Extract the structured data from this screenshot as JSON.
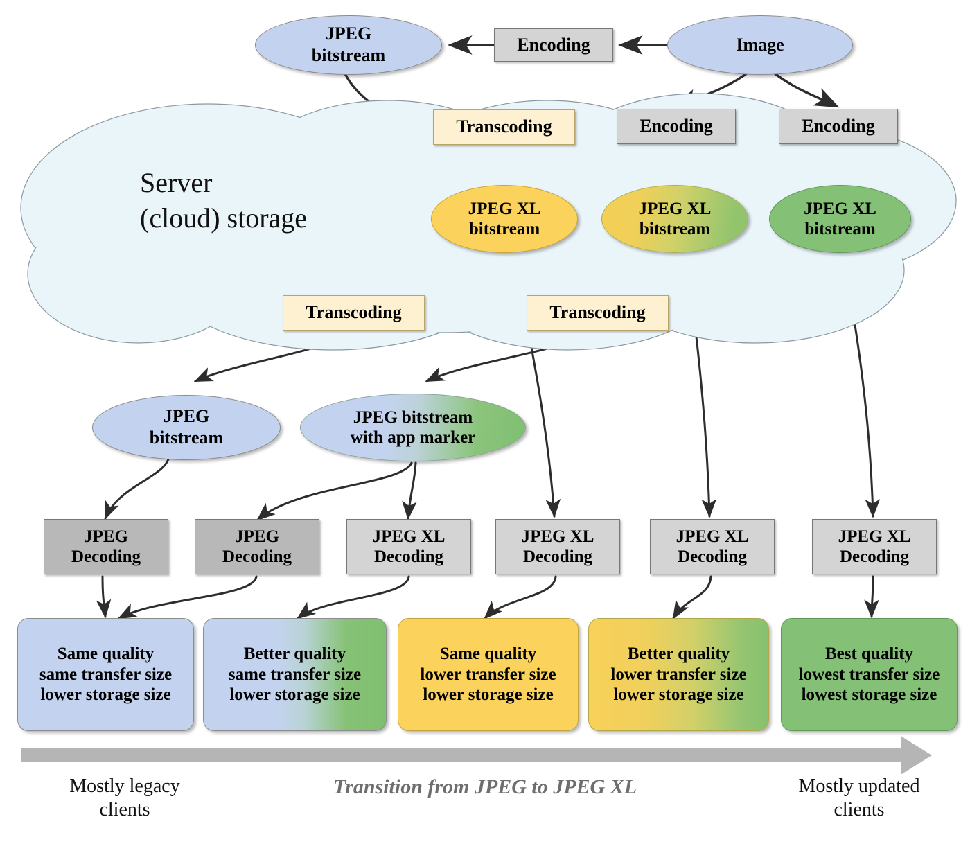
{
  "diagram": {
    "title_text": "Transition from JPEG to JPEG XL",
    "cloud_label_line1": "Server",
    "cloud_label_line2": "(cloud) storage",
    "colors": {
      "blue": "#c3d3ef",
      "amber": "#fbd35c",
      "green": "#84c075",
      "cream": "#fdf1d2",
      "gray": "#d4d4d4",
      "gray_dark": "#b8b8b8",
      "cloud_fill": "#eaf5fa",
      "arrow_gray": "#b3b3b3",
      "emph_text": "#6e6e6e"
    }
  },
  "top_row": {
    "jpeg_bitstream": {
      "line1": "JPEG",
      "line2": "bitstream"
    },
    "encoding": {
      "label": "Encoding"
    },
    "image": {
      "label": "Image"
    }
  },
  "server_row": {
    "transcoding": {
      "label": "Transcoding"
    },
    "encoding_mid": {
      "label": "Encoding"
    },
    "encoding_right": {
      "label": "Encoding"
    },
    "jxl_a": {
      "line1": "JPEG XL",
      "line2": "bitstream"
    },
    "jxl_b": {
      "line1": "JPEG XL",
      "line2": "bitstream"
    },
    "jxl_c": {
      "line1": "JPEG XL",
      "line2": "bitstream"
    }
  },
  "transcode_row": {
    "transcoding_left": {
      "label": "Transcoding"
    },
    "transcoding_right": {
      "label": "Transcoding"
    }
  },
  "client_bitstreams": {
    "jpeg_plain": {
      "line1": "JPEG",
      "line2": "bitstream"
    },
    "jpeg_marker": {
      "line1": "JPEG bitstream",
      "line2": "with app marker"
    }
  },
  "decoders": [
    {
      "line1": "JPEG",
      "line2": "Decoding",
      "tone": "gray-dark"
    },
    {
      "line1": "JPEG",
      "line2": "Decoding",
      "tone": "gray-dark"
    },
    {
      "line1": "JPEG XL",
      "line2": "Decoding",
      "tone": "gray"
    },
    {
      "line1": "JPEG XL",
      "line2": "Decoding",
      "tone": "gray"
    },
    {
      "line1": "JPEG XL",
      "line2": "Decoding",
      "tone": "gray"
    },
    {
      "line1": "JPEG XL",
      "line2": "Decoding",
      "tone": "gray"
    }
  ],
  "results": [
    {
      "line1": "Same quality",
      "line2": "same transfer size",
      "line3": "lower storage size",
      "tone": "blue"
    },
    {
      "line1": "Better quality",
      "line2": "same transfer size",
      "line3": "lower storage size",
      "tone": "blue-green"
    },
    {
      "line1": "Same quality",
      "line2": "lower transfer size",
      "line3": "lower storage size",
      "tone": "amber"
    },
    {
      "line1": "Better quality",
      "line2": "lower transfer size",
      "line3": "lower storage size",
      "tone": "amber-green"
    },
    {
      "line1": "Best quality",
      "line2": "lowest transfer size",
      "line3": "lowest storage size",
      "tone": "green"
    }
  ],
  "axis": {
    "left_label_line1": "Mostly legacy",
    "left_label_line2": "clients",
    "center_label": "Transition from JPEG to JPEG XL",
    "right_label_line1": "Mostly updated",
    "right_label_line2": "clients"
  }
}
